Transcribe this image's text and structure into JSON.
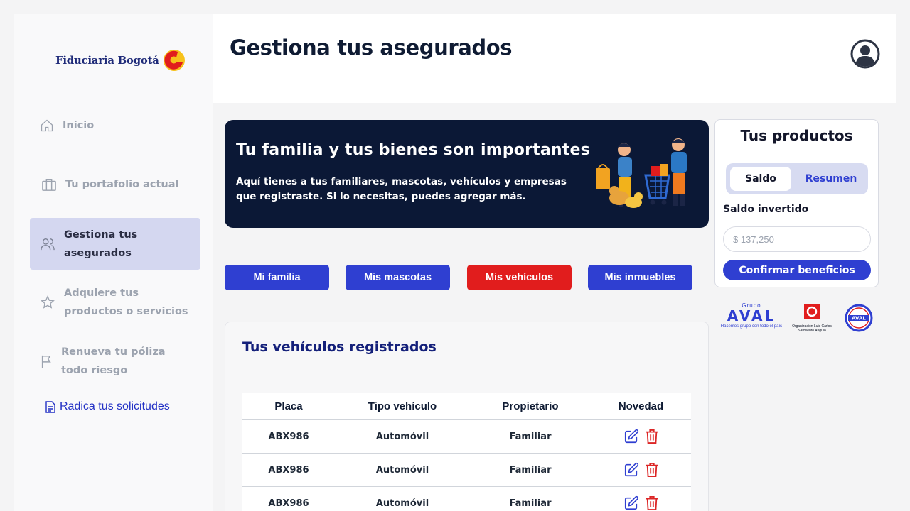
{
  "brand": {
    "name": "Fiduciaria Bogotá"
  },
  "sidebar": {
    "items": [
      {
        "label": "Inicio",
        "icon": "home-icon"
      },
      {
        "label": "Tu portafolio actual",
        "icon": "briefcase-icon"
      },
      {
        "label": "Gestiona tus asegurados",
        "icon": "users-icon",
        "active": true
      },
      {
        "label": "Adquiere tus productos o servicios",
        "icon": "star-icon"
      },
      {
        "label": "Renueva tu póliza todo riesgo",
        "icon": "flag-icon"
      }
    ],
    "link": {
      "label": "Radica tus solicitudes",
      "icon": "document-icon"
    }
  },
  "header": {
    "title": "Gestiona tus asegurados",
    "avatar_icon": "user-avatar-icon"
  },
  "banner": {
    "title": "Tu familia y tus bienes son importantes",
    "text": "Aquí tienes a tus familiares, mascotas, vehículos y empresas que registraste. Si lo necesitas, puedes agregar más."
  },
  "categories": [
    {
      "label": "Mi familia"
    },
    {
      "label": "Mis mascotas"
    },
    {
      "label": "Mis vehículos",
      "active": true
    },
    {
      "label": "Mis inmuebles"
    }
  ],
  "vehicles": {
    "title": "Tus vehículos registrados",
    "columns": [
      "Placa",
      "Tipo vehículo",
      "Propietario",
      "Novedad"
    ],
    "rows": [
      {
        "placa": "ABX986",
        "tipo": "Automóvil",
        "propietario": "Familiar"
      },
      {
        "placa": "ABX986",
        "tipo": "Automóvil",
        "propietario": "Familiar"
      },
      {
        "placa": "ABX986",
        "tipo": "Automóvil",
        "propietario": "Familiar"
      }
    ],
    "row_actions": [
      "edit-icon",
      "trash-icon"
    ]
  },
  "products": {
    "title": "Tus productos",
    "tabs": [
      {
        "label": "Saldo",
        "active": true
      },
      {
        "label": "Resumen"
      }
    ],
    "saldo_label": "Saldo invertido",
    "saldo_placeholder": "$ 137,250",
    "confirm_label": "Confirmar beneficios"
  },
  "partners": {
    "aval_group": "Grupo",
    "aval_name": "AVAL",
    "aval_tagline": "Hacemos grupo con todo el país",
    "olcsa": "Organización Luis Carlos Sarmiento Angulo",
    "seal_text": "AVAL"
  },
  "colors": {
    "primary": "#2f3fd1",
    "active_category": "#e11d1d",
    "banner_bg": "#0b1836",
    "sidebar_active": "#d4d7f0",
    "title_navy": "#14207a",
    "delete_red": "#dc2626"
  }
}
